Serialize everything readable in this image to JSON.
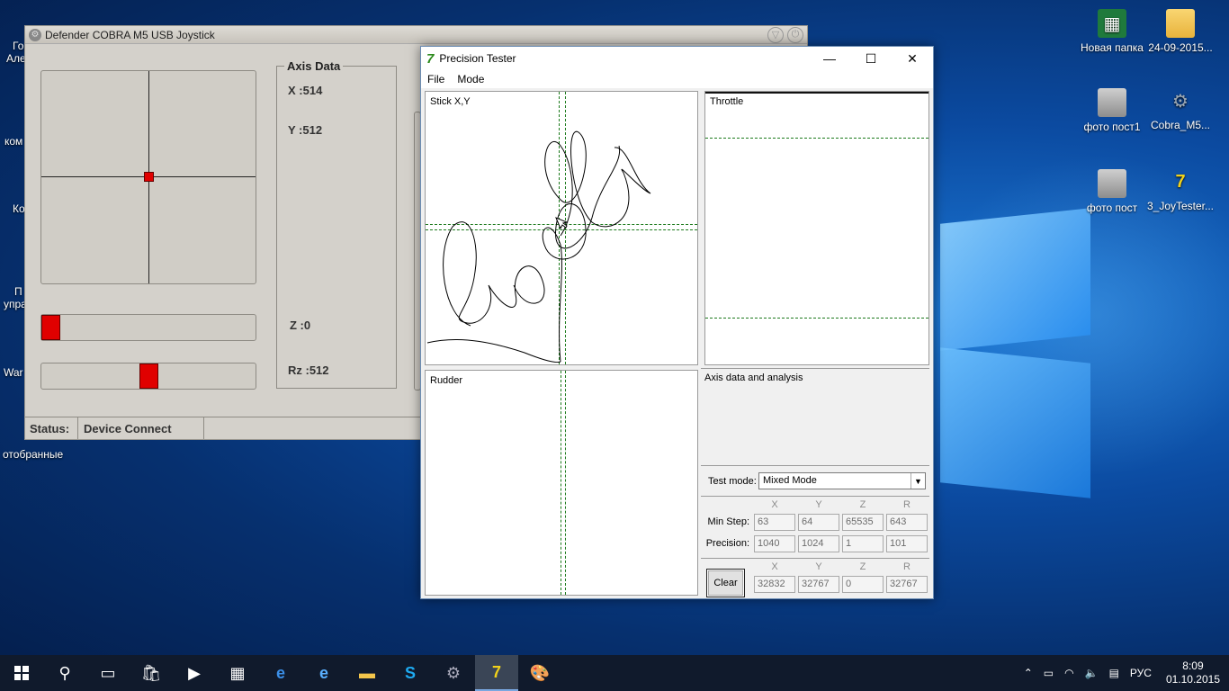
{
  "desktop": {
    "icons_right": [
      {
        "label": "Новая папка",
        "icon": "excel-file-icon"
      },
      {
        "label": "24-09-2015...",
        "icon": "folder-icon"
      },
      {
        "label": "фото пост1",
        "icon": "archive-icon"
      },
      {
        "label": "Cobra_M5...",
        "icon": "gear-icon"
      },
      {
        "label": "фото пост",
        "icon": "archive-icon"
      },
      {
        "label": "3_JoyTester...",
        "icon": "joytester-icon"
      }
    ],
    "left_partial": [
      "Го",
      "Але",
      "ком",
      "Ко",
      "П",
      "упра",
      "War"
    ],
    "bottom_left_label": "отобранные"
  },
  "defender": {
    "title": "Defender COBRA M5 USB Joystick",
    "axis_legend": "Axis Data",
    "x_label": "X :514",
    "y_label": "Y :512",
    "z_label": "Z :0",
    "rz_label": "Rz :512",
    "status_label": "Status:",
    "status_value": "Device Connect",
    "slider1_level": 0.0,
    "slider2_level": 0.5
  },
  "tester": {
    "title": "Precision Tester",
    "menu": [
      "File",
      "Mode"
    ],
    "stick_label": "Stick X,Y",
    "throttle_label": "Throttle",
    "rudder_label": "Rudder",
    "info_label": "Axis data and analysis",
    "test_mode_label": "Test mode:",
    "test_mode_value": "Mixed Mode",
    "columns": [
      "X",
      "Y",
      "Z",
      "R"
    ],
    "min_step_label": "Min Step:",
    "min_step": [
      "63",
      "64",
      "65535",
      "643"
    ],
    "precision_label": "Precision:",
    "precision": [
      "1040",
      "1024",
      "1",
      "101"
    ],
    "clear_label": "Clear",
    "current": [
      "32832",
      "32767",
      "0",
      "32767"
    ]
  },
  "taskbar": {
    "lang": "РУС",
    "time": "8:09",
    "date": "01.10.2015"
  }
}
